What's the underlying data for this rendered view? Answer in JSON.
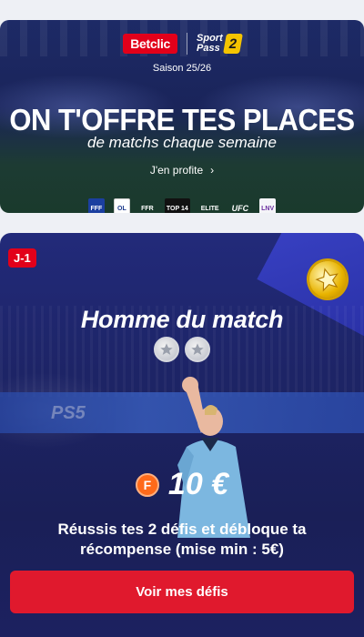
{
  "banner": {
    "brand": "Betclic",
    "sportpass_line1": "Sport",
    "sportpass_line2": "Pass",
    "sportpass_badge": "2",
    "season": "Saison 25/26",
    "title": "ON T'OFFRE TES PLACES",
    "subtitle": "de matchs chaque semaine",
    "cta": "J'en profite",
    "cta_chevron": "›",
    "partners": [
      {
        "name": "fff",
        "label": "FFF"
      },
      {
        "name": "ol",
        "label": "OL"
      },
      {
        "name": "ffr",
        "label": "FFR"
      },
      {
        "name": "top14",
        "label": "TOP 14"
      },
      {
        "name": "elite",
        "label": "ELITE"
      },
      {
        "name": "ufc",
        "label": "UFC"
      },
      {
        "name": "lnv",
        "label": "LNV"
      }
    ]
  },
  "card": {
    "badge": "J-1",
    "title": "Homme du match",
    "stars_total": 2,
    "stars_completed": 0,
    "background_ad": "PS5",
    "coin_letter": "F",
    "reward": "10 €",
    "description": "Réussis tes 2 défis et débloque ta récompense (mise min : 5€)",
    "button": "Voir mes défis"
  },
  "colors": {
    "brand_red": "#e2001a",
    "button_red": "#e0192d",
    "navy": "#1d2466",
    "coin_orange": "#ff6a1a",
    "trophy_gold": "#e8b300"
  }
}
